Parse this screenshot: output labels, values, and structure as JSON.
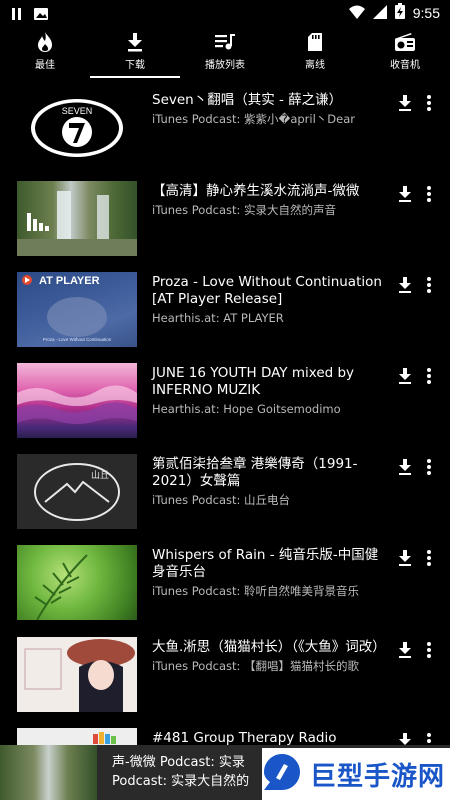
{
  "status_bar": {
    "time": "9:55"
  },
  "tabs": [
    {
      "label": "最佳",
      "icon": "flame-icon",
      "active": false
    },
    {
      "label": "下载",
      "icon": "download-icon",
      "active": true
    },
    {
      "label": "播放列表",
      "icon": "playlist-icon",
      "active": false
    },
    {
      "label": "离线",
      "icon": "sd-card-icon",
      "active": false
    },
    {
      "label": "收音机",
      "icon": "radio-icon",
      "active": false
    }
  ],
  "items": [
    {
      "title": "Seven丶翻唱（其实 - 薛之谦）",
      "subtitle": "iTunes Podcast: 紫紫小�april丶Dear",
      "thumb_label": "SEVEN"
    },
    {
      "title": "【高清】静心养生溪水流淌声-微微",
      "subtitle": "iTunes Podcast: 实录大自然的声音"
    },
    {
      "title": "Proza - Love Without Continuation [AT Player Release]",
      "subtitle": "Hearthis.at: AT PLAYER",
      "thumb_label": "AT PLAYER",
      "thumb_caption": "Proza - Love Without Continuation"
    },
    {
      "title": "JUNE 16 YOUTH DAY mixed by INFERNO MUZIK",
      "subtitle": "Hearthis.at: Hope Goitsemodimo"
    },
    {
      "title": "第贰佰柒拾叁章 港樂傳奇（1991-2021）女聲篇",
      "subtitle": "iTunes Podcast: 山丘电台",
      "thumb_label": "山丘"
    },
    {
      "title": "Whispers of Rain - 纯音乐版-中国健身音乐台",
      "subtitle": "iTunes Podcast: 聆听自然唯美背景音乐"
    },
    {
      "title": "大鱼.淅思（猫猫村长）（《大鱼》词改）",
      "subtitle": "iTunes Podcast: 【翻唱】猫猫村长的歌"
    },
    {
      "title": "#481 Group Therapy Radio",
      "subtitle": ""
    }
  ],
  "mini_player": {
    "line1": "声-微微 Podcast: 实录",
    "line2": "Podcast: 实录大自然的",
    "brand": "巨型手游网"
  },
  "colors": {
    "background": "#000000",
    "text": "#ffffff",
    "subtext": "#b8b8b8",
    "brand": "#1a56c7"
  }
}
